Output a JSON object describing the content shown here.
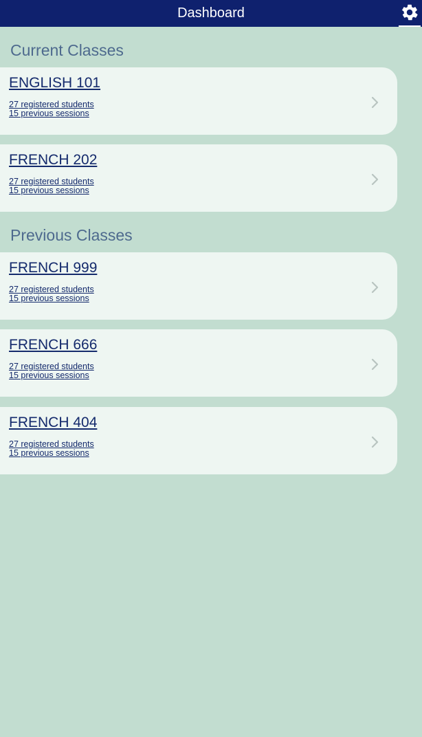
{
  "header": {
    "title": "Dashboard"
  },
  "current_section": {
    "heading": "Current Classes",
    "classes": [
      {
        "name": "ENGLISH 101",
        "students": "27 registered students",
        "sessions": "15 previous sessions"
      },
      {
        "name": "FRENCH 202",
        "students": "27 registered students",
        "sessions": "15 previous sessions"
      }
    ]
  },
  "previous_section": {
    "heading": "Previous Classes",
    "classes": [
      {
        "name": "FRENCH 999",
        "students": "27 registered students",
        "sessions": "15 previous sessions"
      },
      {
        "name": "FRENCH 666",
        "students": "27 registered students",
        "sessions": "15 previous sessions"
      },
      {
        "name": "FRENCH 404",
        "students": "27 registered students",
        "sessions": "15 previous sessions"
      }
    ]
  },
  "icons": {
    "settings": "gear-icon",
    "row_arrow": "chevron-right-icon"
  },
  "colors": {
    "header_bg": "#0f216e",
    "page_bg": "#c2ddd0",
    "card_bg": "#eef6f2",
    "heading_text": "#4e6a8e",
    "link_text": "#142a6c"
  }
}
